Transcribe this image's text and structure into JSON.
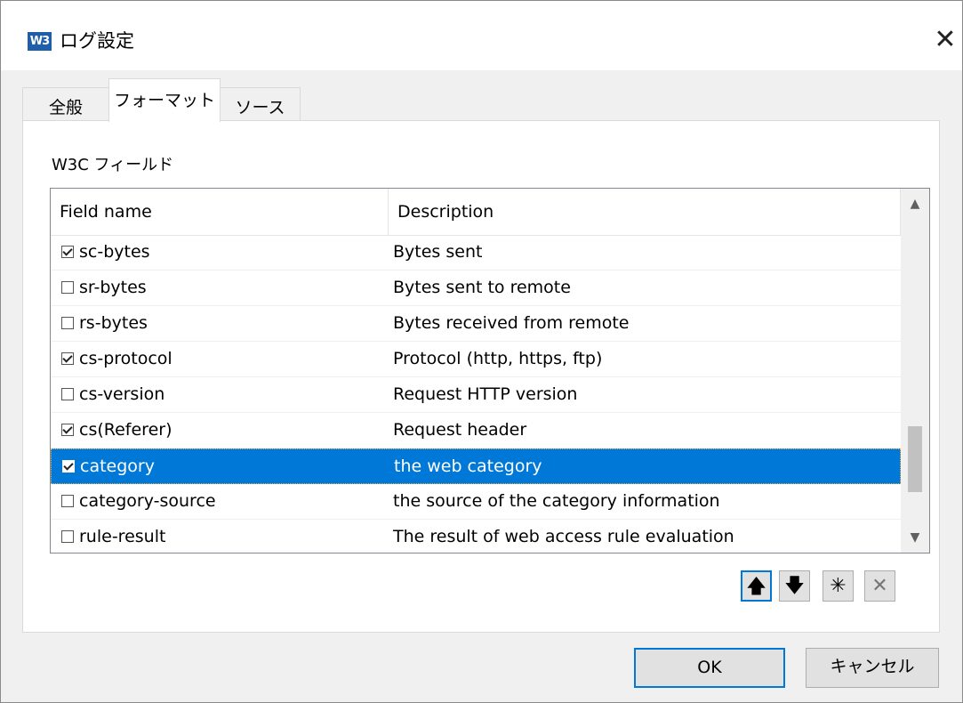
{
  "window": {
    "icon_text": "W3",
    "title": "ログ設定",
    "close_symbol": "✕"
  },
  "tabs": [
    {
      "label": "全般",
      "selected": false
    },
    {
      "label": "フォーマット",
      "selected": true
    },
    {
      "label": "ソース",
      "selected": false
    }
  ],
  "fields_group": {
    "label": "W3C フィールド"
  },
  "list": {
    "columns": [
      "Field name",
      "Description"
    ],
    "rows": [
      {
        "field": "sc-bytes",
        "description": "Bytes sent",
        "checked": true,
        "selected": false
      },
      {
        "field": "sr-bytes",
        "description": "Bytes sent to remote",
        "checked": false,
        "selected": false
      },
      {
        "field": "rs-bytes",
        "description": "Bytes received from remote",
        "checked": false,
        "selected": false
      },
      {
        "field": "cs-protocol",
        "description": "Protocol (http, https, ftp)",
        "checked": true,
        "selected": false
      },
      {
        "field": "cs-version",
        "description": "Request HTTP version",
        "checked": false,
        "selected": false
      },
      {
        "field": "cs(Referer)",
        "description": "Request header",
        "checked": true,
        "selected": false
      },
      {
        "field": "category",
        "description": "the web category",
        "checked": true,
        "selected": true
      },
      {
        "field": "category-source",
        "description": "the source of the category information",
        "checked": false,
        "selected": false
      },
      {
        "field": "rule-result",
        "description": "The result of web access rule evaluation",
        "checked": false,
        "selected": false
      }
    ],
    "scroll_up": "▲",
    "scroll_down": "▼"
  },
  "toolbar": {
    "move_up": "🡅",
    "move_down": "🡇",
    "new": "✳",
    "delete": "✕"
  },
  "buttons": {
    "ok": "OK",
    "cancel": "キャンセル"
  },
  "colors": {
    "selection": "#0078d7",
    "focus_border": "#0078d7"
  }
}
